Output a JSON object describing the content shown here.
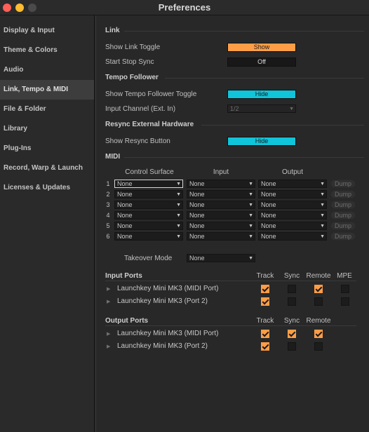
{
  "window": {
    "title": "Preferences"
  },
  "sidebar": {
    "items": [
      {
        "label": "Display & Input"
      },
      {
        "label": "Theme & Colors"
      },
      {
        "label": "Audio"
      },
      {
        "label": "Link, Tempo & MIDI",
        "active": true
      },
      {
        "label": "File & Folder"
      },
      {
        "label": "Library"
      },
      {
        "label": "Plug-Ins"
      },
      {
        "label": "Record, Warp & Launch"
      },
      {
        "label": "Licenses & Updates"
      }
    ]
  },
  "link": {
    "heading": "Link",
    "show_toggle_label": "Show Link Toggle",
    "show_toggle_value": "Show",
    "start_stop_label": "Start Stop Sync",
    "start_stop_value": "Off"
  },
  "tempo": {
    "heading": "Tempo Follower",
    "show_toggle_label": "Show Tempo Follower Toggle",
    "show_toggle_value": "Hide",
    "input_channel_label": "Input Channel (Ext. In)",
    "input_channel_value": "1/2"
  },
  "resync": {
    "heading": "Resync External Hardware",
    "show_button_label": "Show Resync Button",
    "show_button_value": "Hide"
  },
  "midi": {
    "heading": "MIDI",
    "col_control_surface": "Control Surface",
    "col_input": "Input",
    "col_output": "Output",
    "rows": [
      {
        "num": "1",
        "cs": "None",
        "input": "None",
        "output": "None",
        "dump": "Dump"
      },
      {
        "num": "2",
        "cs": "None",
        "input": "None",
        "output": "None",
        "dump": "Dump"
      },
      {
        "num": "3",
        "cs": "None",
        "input": "None",
        "output": "None",
        "dump": "Dump"
      },
      {
        "num": "4",
        "cs": "None",
        "input": "None",
        "output": "None",
        "dump": "Dump"
      },
      {
        "num": "5",
        "cs": "None",
        "input": "None",
        "output": "None",
        "dump": "Dump"
      },
      {
        "num": "6",
        "cs": "None",
        "input": "None",
        "output": "None",
        "dump": "Dump"
      }
    ],
    "takeover_label": "Takeover Mode",
    "takeover_value": "None"
  },
  "input_ports": {
    "heading": "Input Ports",
    "col_track": "Track",
    "col_sync": "Sync",
    "col_remote": "Remote",
    "col_mpe": "MPE",
    "rows": [
      {
        "name": "Launchkey Mini MK3 (MIDI Port)",
        "track": true,
        "sync": false,
        "remote": true,
        "mpe": false
      },
      {
        "name": "Launchkey Mini MK3 (Port 2)",
        "track": true,
        "sync": false,
        "remote": false,
        "mpe": false
      }
    ]
  },
  "output_ports": {
    "heading": "Output Ports",
    "col_track": "Track",
    "col_sync": "Sync",
    "col_remote": "Remote",
    "rows": [
      {
        "name": "Launchkey Mini MK3 (MIDI Port)",
        "track": true,
        "sync": true,
        "remote": true
      },
      {
        "name": "Launchkey Mini MK3 (Port 2)",
        "track": true,
        "sync": false,
        "remote": false
      }
    ]
  },
  "colors": {
    "accent_orange": "#ff9d47",
    "accent_cyan": "#10c4d9",
    "background": "#282828"
  }
}
